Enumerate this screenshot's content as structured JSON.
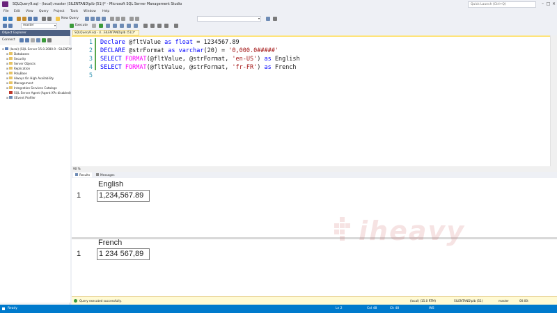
{
  "window": {
    "title": "SQLQuery9.sql - (local).master (SILENTAND\\plb (51))* - Microsoft SQL Server Management Studio",
    "quick_launch_placeholder": "Quick Launch (Ctrl+Q)"
  },
  "menu": [
    "File",
    "Edit",
    "View",
    "Query",
    "Project",
    "Tools",
    "Window",
    "Help"
  ],
  "toolbar": {
    "new_query": "New Query",
    "execute": "Execute",
    "database": "master"
  },
  "object_explorer": {
    "title": "Object Explorer",
    "connect": "Connect",
    "tree": [
      {
        "label": "(local) (SQL Server 15.0.2080.9 - SILENTAND\\plb)",
        "level": 0,
        "expander": "⊟"
      },
      {
        "label": "Databases",
        "level": 1,
        "expander": "⊞"
      },
      {
        "label": "Security",
        "level": 1,
        "expander": "⊞"
      },
      {
        "label": "Server Objects",
        "level": 1,
        "expander": "⊞"
      },
      {
        "label": "Replication",
        "level": 1,
        "expander": "⊞"
      },
      {
        "label": "PolyBase",
        "level": 1,
        "expander": "⊞"
      },
      {
        "label": "Always On High Availability",
        "level": 1,
        "expander": "⊞"
      },
      {
        "label": "Management",
        "level": 1,
        "expander": "⊞"
      },
      {
        "label": "Integration Services Catalogs",
        "level": 1,
        "expander": "⊞"
      },
      {
        "label": "SQL Server Agent (Agent XPs disabled)",
        "level": 1,
        "expander": ""
      },
      {
        "label": "XEvent Profiler",
        "level": 1,
        "expander": "⊞"
      }
    ]
  },
  "doc_tab": "SQLQuery9.sql - (l...SILENTAND\\plb (51))*",
  "editor": {
    "line_numbers": [
      "1",
      "2",
      "3",
      "4",
      "5"
    ],
    "line1": {
      "a": "Declare",
      "b": " @fltValue ",
      "c": "as",
      "d": " ",
      "e": "float",
      "f": " = 1234567.89"
    },
    "line2": {
      "a": "DECLARE",
      "b": " @strFormat ",
      "c": "as",
      "d": " ",
      "e": "varchar",
      "f": "(20) = ",
      "g": "'0,000.0#####'"
    },
    "line3": {
      "a": "SELECT",
      "b": " ",
      "c": "FORMAT",
      "d": "(@fltValue, @strFormat, ",
      "e": "'en-US'",
      "f": ") ",
      "g": "as",
      "h": " English"
    },
    "line4": {
      "a": "SELECT",
      "b": " ",
      "c": "FORMAT",
      "d": "(@fltValue, @strFormat, ",
      "e": "'fr-FR'",
      "f": ") ",
      "g": "as",
      "h": " French"
    }
  },
  "zoom": "90 %",
  "result_tabs": {
    "results": "Results",
    "messages": "Messages"
  },
  "results": [
    {
      "column": "English",
      "row_number": "1",
      "value": "1,234,567.89"
    },
    {
      "column": "French",
      "row_number": "1",
      "value": "1 234 567,89"
    }
  ],
  "watermark": "iheavy",
  "query_status": {
    "message": "Query executed successfully.",
    "server": "(local) (15.0 RTM)",
    "user": "SILENTAND\\plb (51)",
    "database": "master",
    "time": "00:00:"
  },
  "status_bar": {
    "ready": "Ready",
    "ln": "Ln 2",
    "col": "Col 48",
    "ch": "Ch 48",
    "ins": "INS"
  },
  "colors": {
    "accent_blue": "#007acc",
    "keyword": "#0000ff",
    "string": "#a31515",
    "function": "#ff00ff"
  }
}
